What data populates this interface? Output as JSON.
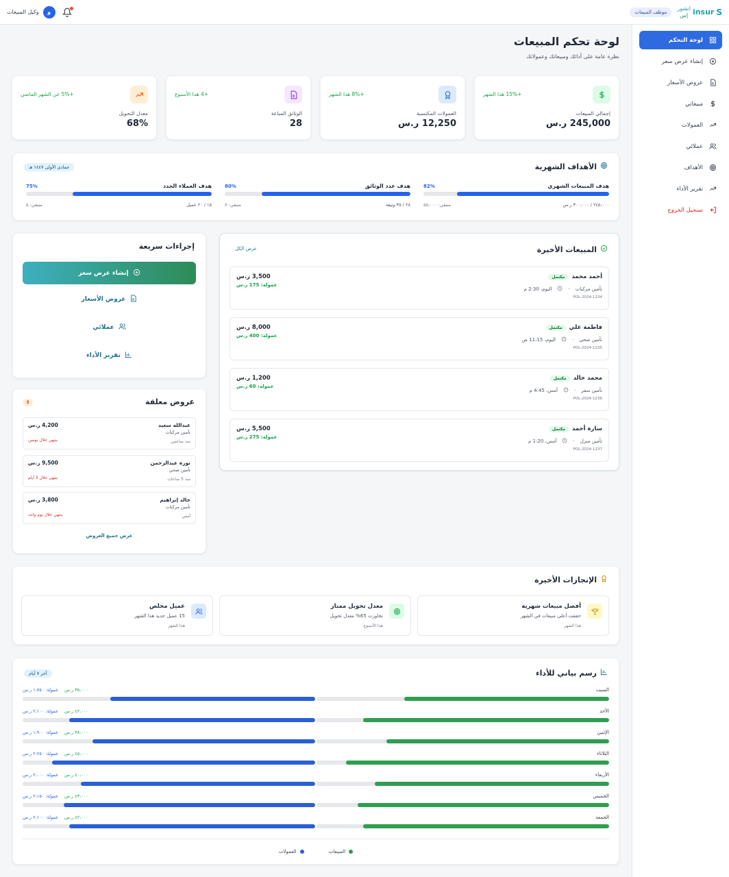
{
  "header": {
    "logo_letter": "S",
    "logo_en": "insur",
    "logo_ar_1": "انشور",
    "logo_ar_2": "إس",
    "role": "موظف المبيعات",
    "agent_name": "وكيل المبيعات",
    "avatar_initial": "و"
  },
  "sidebar": {
    "items": [
      {
        "label": "لوحة التحكم",
        "icon": "grid-icon"
      },
      {
        "label": "إنشاء عرض سعر",
        "icon": "plus-circle-icon"
      },
      {
        "label": "عروض الأسعار",
        "icon": "document-icon"
      },
      {
        "label": "مبيعاتي",
        "icon": "dollar-icon"
      },
      {
        "label": "العمولات",
        "icon": "trend-icon"
      },
      {
        "label": "عملائي",
        "icon": "users-icon"
      },
      {
        "label": "الأهداف",
        "icon": "target-icon"
      },
      {
        "label": "تقرير الأداء",
        "icon": "trend-icon"
      }
    ],
    "logout": "تسجيل الخروج"
  },
  "page": {
    "title": "لوحة تحكم المبيعات",
    "subtitle": "نظرة عامة على أدائك ومبيعاتك وعمولاتك"
  },
  "stats": [
    {
      "label": "إجمالي المبيعات",
      "value": "245,000 ر.س",
      "delta": "+15% هذا الشهر",
      "icon": "dollar-icon",
      "bg": "#dcfce7",
      "fg": "#16a34a"
    },
    {
      "label": "العمولات المكتسبة",
      "value": "12,250 ر.س",
      "delta": "+8% هذا الشهر",
      "icon": "award-icon",
      "bg": "#dbeafe",
      "fg": "#2563eb"
    },
    {
      "label": "الوثائق المباعة",
      "value": "28",
      "delta": "+4 هذا الأسبوع",
      "icon": "document-icon",
      "bg": "#f3e8ff",
      "fg": "#9333ea"
    },
    {
      "label": "معدل التحويل",
      "value": "68%",
      "delta": "+5% عن الشهر الماضي",
      "icon": "trend-up-icon",
      "bg": "#ffedd5",
      "fg": "#ea580c"
    }
  ],
  "goals": {
    "title": "الأهداف الشهرية",
    "period": "جمادى الأولى ١٤٤٧ هـ",
    "items": [
      {
        "label": "هدف المبيعات الشهري",
        "percent": "82%",
        "fill": 0.82,
        "current": "٢٤٥،٠٠٠ / ٣٠٠،٠٠٠ ر.س",
        "remaining": "متبقي: ٥٥،٠٠٠"
      },
      {
        "label": "هدف عدد الوثائق",
        "percent": "80%",
        "fill": 0.8,
        "current": "٢٨ / ٣٥ وثيقة",
        "remaining": "متبقي: ٧"
      },
      {
        "label": "هدف العملاء الجدد",
        "percent": "75%",
        "fill": 0.75,
        "current": "١٥ / ٢٠ عميل",
        "remaining": "متبقي: ٥"
      }
    ]
  },
  "recent_sales": {
    "title": "المبيعات الأخيرة",
    "view_all": "عرض الكل",
    "items": [
      {
        "name": "أحمد محمد",
        "status": "مكتمل",
        "type": "تأمين مركبات",
        "time": "اليوم، 2:30 م",
        "policy": "POL-2024-1234",
        "amount": "3,500 ر.س",
        "commission": "عمولة: 175 ر.س"
      },
      {
        "name": "فاطمة علي",
        "status": "مكتمل",
        "type": "تأمين صحي",
        "time": "اليوم، 11:15 ص",
        "policy": "POL-2024-1235",
        "amount": "8,000 ر.س",
        "commission": "عمولة: 400 ر.س"
      },
      {
        "name": "محمد خالد",
        "status": "مكتمل",
        "type": "تأمين سفر",
        "time": "أمس، 4:45 م",
        "policy": "POL-2024-1236",
        "amount": "1,200 ر.س",
        "commission": "عمولة: 60 ر.س"
      },
      {
        "name": "سارة أحمد",
        "status": "مكتمل",
        "type": "تأمين منزل",
        "time": "أمس، 1:20 م",
        "policy": "POL-2024-1237",
        "amount": "5,500 ر.س",
        "commission": "عمولة: 275 ر.س"
      }
    ]
  },
  "quick_actions": {
    "title": "إجراءات سريعة",
    "primary": "إنشاء عرض سعر",
    "items": [
      {
        "label": "عروض الأسعار",
        "icon": "document-icon"
      },
      {
        "label": "عملائي",
        "icon": "users-icon"
      },
      {
        "label": "تقرير الأداء",
        "icon": "bar-chart-icon"
      }
    ]
  },
  "pending": {
    "title": "عروض معلقة",
    "count": "3",
    "view_all": "عرض جميع العروض",
    "items": [
      {
        "name": "عبدالله سعيد",
        "type": "تأمين مركبات",
        "ago": "منذ ساعتين",
        "amount": "4,200 ر.س",
        "expiry": "ينتهي خلال يومين"
      },
      {
        "name": "نورة عبدالرحمن",
        "type": "تأمين صحي",
        "ago": "منذ 5 ساعات",
        "amount": "9,500 ر.س",
        "expiry": "ينتهي خلال 3 أيام"
      },
      {
        "name": "خالد إبراهيم",
        "type": "تأمين مركبات",
        "ago": "أمس",
        "amount": "3,800 ر.س",
        "expiry": "ينتهي خلال يوم واحد"
      }
    ]
  },
  "achievements": {
    "title": "الإنجازات الأخيرة",
    "items": [
      {
        "title": "أفضل مبيعات شهرية",
        "desc": "حققت أعلى مبيعات في الشهر",
        "period": "هذا الشهر",
        "icon": "trophy-icon",
        "bg": "#fef9c3",
        "fg": "#ca8a04"
      },
      {
        "title": "معدل تحويل ممتاز",
        "desc": "تجاوزت 65% معدل تحويل",
        "period": "هذا الأسبوع",
        "icon": "target-icon",
        "bg": "#dcfce7",
        "fg": "#16a34a"
      },
      {
        "title": "عميل مخلص",
        "desc": "15 عميل جديد هذا الشهر",
        "period": "هذا الشهر",
        "icon": "users-icon",
        "bg": "#dbeafe",
        "fg": "#2563eb"
      }
    ]
  },
  "chart_data": {
    "type": "bar",
    "title": "رسم بياني للأداء",
    "period": "آخر ٧ أيام",
    "categories": [
      "السبت",
      "الأحد",
      "الإثنين",
      "الثلاثاء",
      "الأربعاء",
      "الخميس",
      "الجمعة"
    ],
    "series": [
      {
        "name": "المبيعات",
        "color": "#2e9e4f",
        "values": [
          0.7,
          0.84,
          0.76,
          0.9,
          0.8,
          0.86,
          0.84
        ]
      },
      {
        "name": "العمولات",
        "color": "#2a5fd6",
        "values": [
          0.7,
          0.84,
          0.76,
          0.9,
          0.8,
          0.86,
          0.84
        ]
      }
    ],
    "sales_labels": [
      "٣٥،٠٠٠ ر.س",
      "٤٢،٠٠٠ ر.س",
      "٣٨،٠٠٠ ر.س",
      "٤٥،٠٠٠ ر.س",
      "٤٠،٠٠٠ ر.س",
      "٤٣،٠٠٠ ر.س",
      "٤٢،٠٠٠ ر.س"
    ],
    "commission_labels": [
      "عمولة: ١،٧٥٠ ر.س",
      "عمولة: ٢،١٠٠ ر.س",
      "عمولة: ١،٩٠٠ ر.س",
      "عمولة: ٢،٢٥٠ ر.س",
      "عمولة: ٢،٠٠٠ ر.س",
      "عمولة: ٢،١٥٠ ر.س",
      "عمولة: ٢،١٠٠ ر.س"
    ]
  }
}
